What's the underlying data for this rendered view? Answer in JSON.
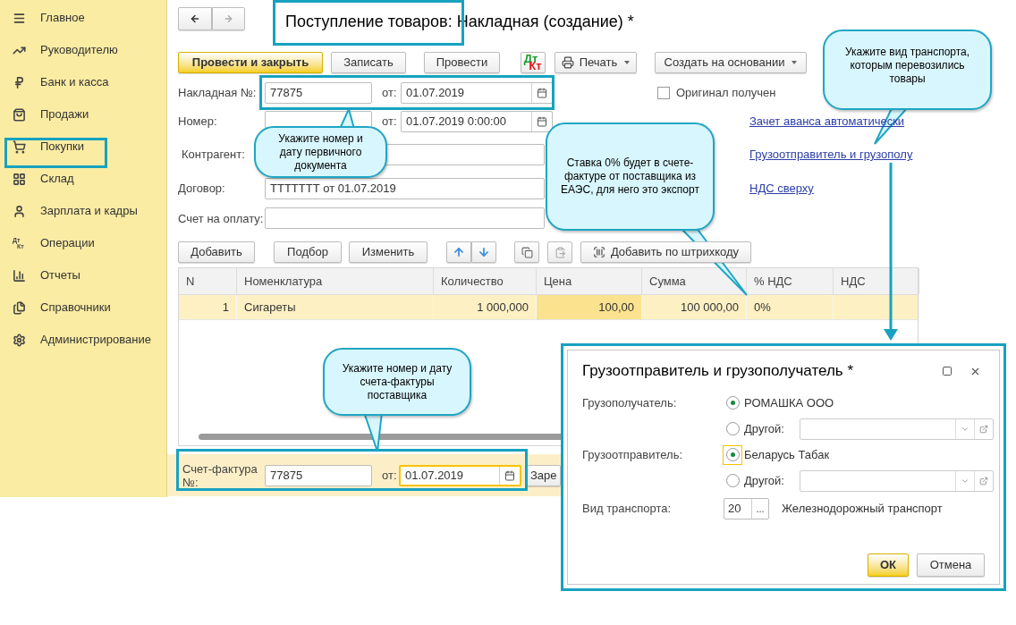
{
  "sidebar": {
    "items": [
      {
        "label": "Главное"
      },
      {
        "label": "Руководителю"
      },
      {
        "label": "Банк и касса"
      },
      {
        "label": "Продажи"
      },
      {
        "label": "Покупки"
      },
      {
        "label": "Склад"
      },
      {
        "label": "Зарплата и кадры"
      },
      {
        "label": "Операции",
        "icon_text": [
          "Дт",
          "Кт"
        ]
      },
      {
        "label": "Отчеты"
      },
      {
        "label": "Справочники"
      },
      {
        "label": "Администрирование"
      }
    ]
  },
  "title": "Поступление товаров: Накладная (создание) *",
  "toolbar": [
    {
      "kind": "primary",
      "label": "Провести и закрыть"
    },
    {
      "kind": "plain",
      "label": "Записать"
    },
    {
      "kind": "plain",
      "label": "Провести"
    },
    {
      "kind": "dtkt",
      "dt": "Дт",
      "kt": "Кт"
    },
    {
      "kind": "print",
      "label": "Печать"
    },
    {
      "kind": "menu",
      "label": "Создать на основании"
    }
  ],
  "invoice": {
    "label": "Накладная №:",
    "number": "77875",
    "date_label": "от:",
    "date": "01.07.2019"
  },
  "original_received": {
    "label": "Оригинал получен",
    "checked": false
  },
  "number": {
    "label": "Номер:",
    "date_label": "от:",
    "date": "01.07.2019  0:00:00"
  },
  "counterparty": {
    "label": "Контрагент:"
  },
  "contract": {
    "label": "Договор:",
    "value": "ТТТТТТТ от 01.07.2019"
  },
  "payment_invoice": {
    "label": "Счет на оплату:"
  },
  "links": [
    "Зачет аванса автоматически",
    "Грузоотправитель и грузополу",
    "НДС сверху"
  ],
  "table_toolbar": {
    "buttons": [
      "Добавить",
      "Подбор",
      "Изменить"
    ],
    "barcode": "Добавить по штрихкоду"
  },
  "table": {
    "columns": [
      "N",
      "Номенклатура",
      "Количество",
      "Цена",
      "Сумма",
      "% НДС",
      "НДС"
    ],
    "rows": [
      {
        "selected": true,
        "cells": [
          "1",
          "Сигареты",
          "1 000,000",
          "100,00",
          "100 000,00",
          "0%",
          ""
        ]
      }
    ]
  },
  "bottom": {
    "label": "Счет-фактура №:",
    "number": "77875",
    "date_label": "от:",
    "date": "01.07.2019",
    "button": "Заре"
  },
  "callouts": [
    "Укажите номер и дату первичного документа",
    "Ставка 0% будет в счете-фактуре от поставщика из ЕАЭС, для него это экспорт",
    "Укажите вид транспорта, которым перевозились товары",
    "Укажите номер и дату счета-фактуры поставщика"
  ],
  "dialog": {
    "title": "Грузоотправитель и грузополучатель *",
    "groups": [
      {
        "label": "Грузополучатель:",
        "options": [
          {
            "kind": "value",
            "label": "РОМАШКА ООО",
            "selected": true,
            "focused": false
          },
          {
            "kind": "other",
            "label": "Другой:",
            "selected": false,
            "focused": false
          }
        ]
      },
      {
        "label": "Грузоотправитель:",
        "options": [
          {
            "kind": "value",
            "label": "Беларусь Табак",
            "selected": true,
            "focused": true
          },
          {
            "kind": "other",
            "label": "Другой:",
            "selected": false,
            "focused": false
          }
        ]
      }
    ],
    "transport": {
      "label": "Вид транспорта:",
      "code": "20",
      "button": "...",
      "value": "Железнодорожный транспорт"
    },
    "ok": "ОК",
    "cancel": "Отмена"
  }
}
